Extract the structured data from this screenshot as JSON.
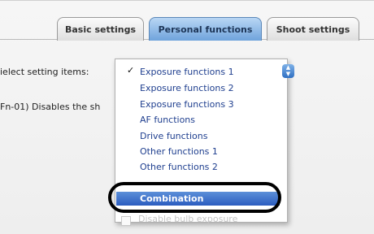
{
  "tabs": [
    {
      "label": "Basic settings"
    },
    {
      "label": "Personal functions"
    },
    {
      "label": "Shoot settings"
    }
  ],
  "select_label": "ielect setting items:",
  "description": "Fn-01) Disables the sh",
  "menu": {
    "checked_index": 0,
    "items": [
      {
        "label": "Exposure functions 1"
      },
      {
        "label": "Exposure functions 2"
      },
      {
        "label": "Exposure functions 3"
      },
      {
        "label": "AF functions"
      },
      {
        "label": "Drive functions"
      },
      {
        "label": "Other functions 1"
      },
      {
        "label": "Other functions 2"
      }
    ],
    "selected": {
      "label": "Combination"
    }
  },
  "below_option": {
    "label": "Disable bulb exposure"
  }
}
